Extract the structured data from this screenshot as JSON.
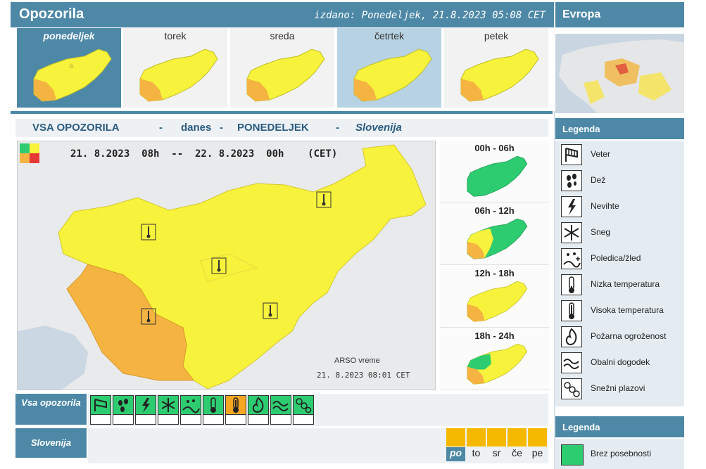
{
  "header": {
    "title": "Opozorila",
    "issued": "izdano: Ponedeljek, 21.8.2023 05:08 CET",
    "europe_title": "Evropa"
  },
  "days": [
    {
      "label": "ponedeljek",
      "selected": true
    },
    {
      "label": "torek"
    },
    {
      "label": "sreda"
    },
    {
      "label": "četrtek",
      "alt": true
    },
    {
      "label": "petek"
    }
  ],
  "section": {
    "title": "VSA OPOZORILA",
    "dash": "-",
    "when": "danes",
    "day": "PONEDELJEK",
    "region": "Slovenija"
  },
  "main_map": {
    "period": "21. 8.2023  08h  --  22. 8.2023  00h    (CET)",
    "source": "ARSO vreme",
    "source_date": "21. 8.2023  08:01 CET"
  },
  "time_slots": [
    {
      "label": "00h - 06h"
    },
    {
      "label": "06h - 12h"
    },
    {
      "label": "12h - 18h"
    },
    {
      "label": "18h - 24h"
    }
  ],
  "legend": {
    "title": "Legenda",
    "items": [
      {
        "label": "Veter",
        "icon": "wind-icon"
      },
      {
        "label": "Dež",
        "icon": "rain-icon"
      },
      {
        "label": "Nevihte",
        "icon": "lightning-icon"
      },
      {
        "label": "Sneg",
        "icon": "snowflake-icon"
      },
      {
        "label": "Poledica/žled",
        "icon": "ice-icon"
      },
      {
        "label": "Nizka temperatura",
        "icon": "thermometer-low-icon"
      },
      {
        "label": "Visoka temperatura",
        "icon": "thermometer-high-icon"
      },
      {
        "label": "Požarna ogroženost",
        "icon": "fire-icon"
      },
      {
        "label": "Obalni dogodek",
        "icon": "wave-icon"
      },
      {
        "label": "Snežni plazovi",
        "icon": "avalanche-icon"
      }
    ]
  },
  "legend2": {
    "title": "Legenda",
    "items": [
      {
        "label": "Brez posebnosti",
        "color": "#2ecc71"
      }
    ]
  },
  "bottom": {
    "all_label": "Vsa opozorila",
    "region_label": "Slovenija",
    "mini_days": [
      "po",
      "to",
      "sr",
      "če",
      "pe"
    ]
  },
  "colors": {
    "accent": "#4d88a6",
    "yellow": "#f7f23b",
    "orange": "#f5b342",
    "green": "#2ecc71"
  }
}
